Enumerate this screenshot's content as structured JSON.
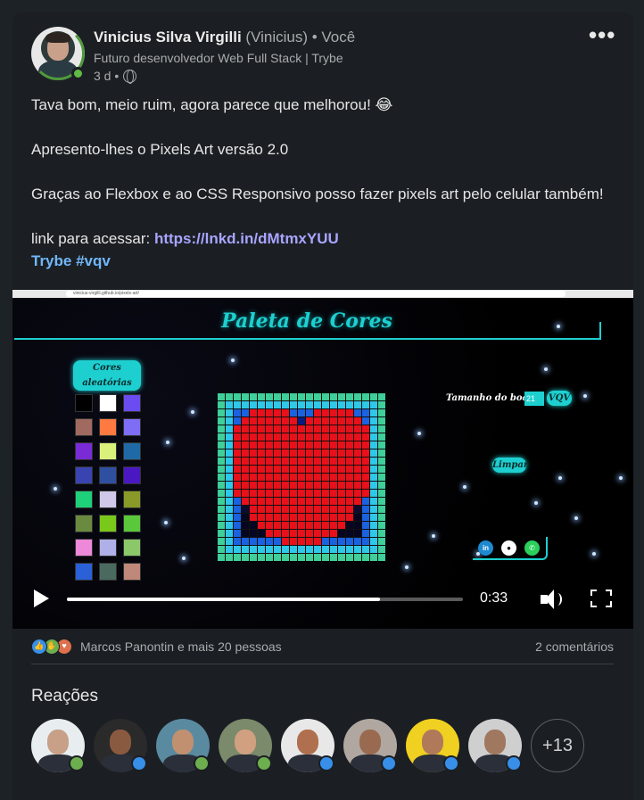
{
  "post": {
    "author_name": "Vinicius Silva Virgilli",
    "author_handle": "(Vinicius)",
    "author_relation": "• Você",
    "author_headline": "Futuro desenvolvedor Web Full Stack | Trybe",
    "time_ago": "3 d •",
    "more_icon": "more-options-icon",
    "line1": "Tava bom, meio ruim, agora parece que melhorou! 😂",
    "line2": "Apresento-lhes o Pixels Art versão 2.0",
    "line3": "Graças ao Flexbox e ao CSS Responsivo posso fazer pixels art pelo celular também!",
    "link_prefix": "link para acessar: ",
    "link_url": "https://lnkd.in/dMtmxYUU",
    "hashtags": "Trybe #vqv"
  },
  "video": {
    "browser_url": "vinicius-virgilli.github.io/pixels-art/",
    "app_title": "Paleta de Cores",
    "random_colors_button": "Cores aleatórias",
    "board_size_label": "Tamanho do board",
    "board_size_value": "21",
    "vqv_button": "VQV",
    "clear_button": "Limpar",
    "social_icons": [
      "linkedin-icon",
      "github-icon",
      "whatsapp-icon"
    ],
    "swatch_colors": [
      "#000000",
      "#ffffff",
      "#6a4cf0",
      "#a06a60",
      "#ff7a40",
      "#7d6ef5",
      "#7a2bd6",
      "#d9f07a",
      "#1f6aa6",
      "#3a44b0",
      "#2f4fa0",
      "#4a18c0",
      "#1ed07a",
      "#cfc8e8",
      "#8a9a28",
      "#6a8a40",
      "#7ac81a",
      "#5ac83a",
      "#ee88d8",
      "#b0b0e8",
      "#8ac86a",
      "#2a60d8",
      "#4a6a60",
      "#c08878"
    ],
    "time": "0:33",
    "progress_fraction": 0.79
  },
  "social": {
    "reaction_icons": [
      "like-icon",
      "support-icon",
      "love-icon"
    ],
    "reactions_text": "Marcos Panontin e mais 20 pessoas",
    "comments_text": "2 comentários",
    "reactions_title": "Reações",
    "more_count": "+13",
    "people": [
      {
        "bg": "#e8eef0",
        "skin": "#c8a088",
        "badge": "support"
      },
      {
        "bg": "#2a2a2a",
        "skin": "#8a5a40",
        "badge": "like"
      },
      {
        "bg": "#5a8aa0",
        "skin": "#c09070",
        "badge": "support"
      },
      {
        "bg": "#7a8a6a",
        "skin": "#d0a080",
        "badge": "support"
      },
      {
        "bg": "#e8e8e8",
        "skin": "#b07050",
        "badge": "like"
      },
      {
        "bg": "#b0a8a0",
        "skin": "#9a6a50",
        "badge": "like"
      },
      {
        "bg": "#f0d020",
        "skin": "#b07a5a",
        "badge": "like"
      },
      {
        "bg": "#cfcfcf",
        "skin": "#a07860",
        "badge": "like"
      }
    ]
  }
}
